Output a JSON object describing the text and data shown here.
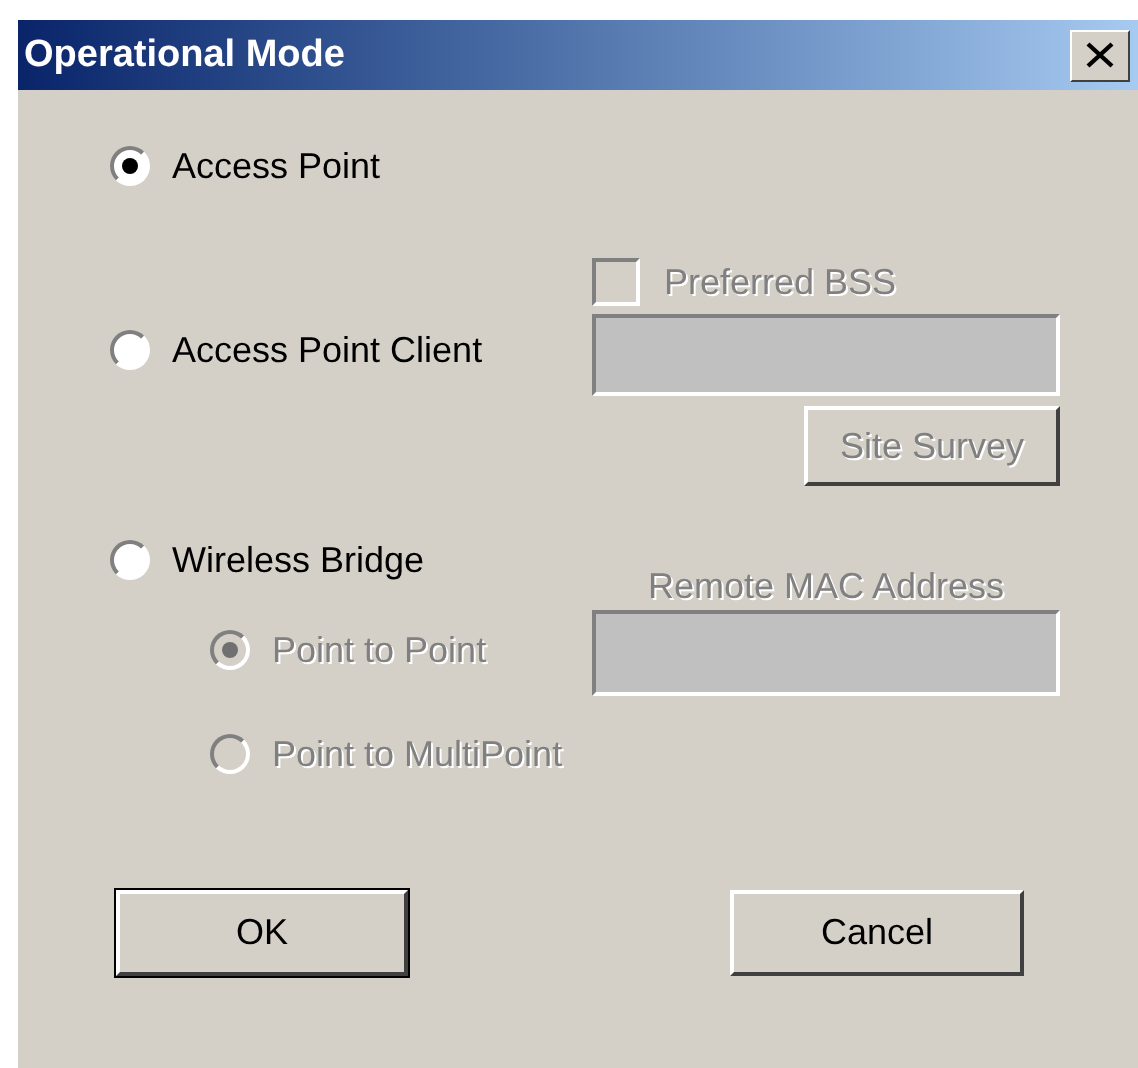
{
  "window": {
    "title": "Operational Mode"
  },
  "modes": [
    {
      "label": "Access Point",
      "selected": true
    },
    {
      "label": "Access Point Client",
      "selected": false
    },
    {
      "label": "Wireless Bridge",
      "selected": false
    }
  ],
  "client": {
    "preferred_bss": {
      "label": "Preferred BSS",
      "checked": false,
      "disabled": true
    },
    "bss_field": {
      "disabled": true
    },
    "site_survey": {
      "label": "Site Survey",
      "disabled": true
    }
  },
  "bridge": {
    "remote_mac": {
      "label": "Remote MAC Address",
      "disabled": true
    },
    "mac_field": {
      "disabled": true
    },
    "submodes": [
      {
        "label": "Point to Point",
        "selected": true,
        "disabled": true
      },
      {
        "label": "Point to MultiPoint",
        "selected": false,
        "disabled": true
      }
    ]
  },
  "buttons": [
    {
      "label": "OK",
      "default": true
    },
    {
      "label": "Cancel",
      "default": false
    }
  ]
}
